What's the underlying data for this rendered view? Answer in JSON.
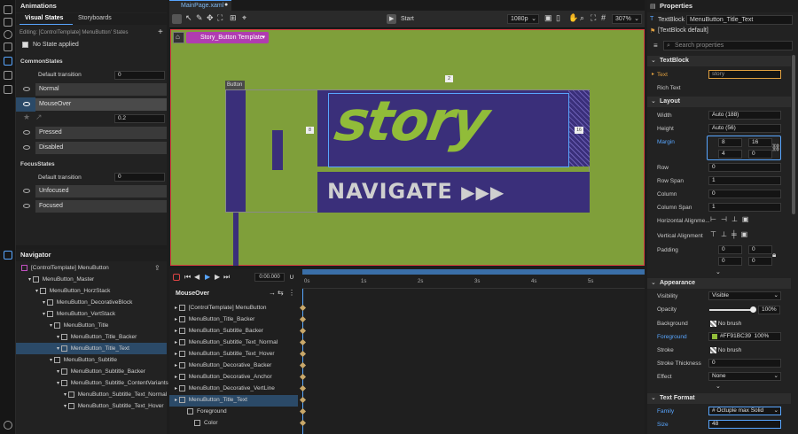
{
  "animations": {
    "title": "Animations",
    "tab_visual": "Visual States",
    "tab_story": "Storyboards",
    "editing": "Editing: [ControlTemplate] MenuButton' States",
    "no_state": "No State applied",
    "group1": "CommonStates",
    "default_transition": "Default transition",
    "dt1": "0",
    "states1": [
      "Normal",
      "MouseOver",
      "Pressed",
      "Disabled"
    ],
    "mouseover_value": "0.2",
    "group2": "FocusStates",
    "dt2": "0",
    "states2": [
      "Unfocused",
      "Focused"
    ]
  },
  "navigator": {
    "title": "Navigator",
    "items": [
      {
        "label": "[ControlTemplate] MenuButton",
        "level": 0
      },
      {
        "label": "MenuButton_Master",
        "level": 1
      },
      {
        "label": "MenuButton_HorzStack",
        "level": 2
      },
      {
        "label": "MenuButton_DecorativeBlock",
        "level": 3
      },
      {
        "label": "MenuButton_VertStack",
        "level": 3
      },
      {
        "label": "MenuButton_Title",
        "level": 4
      },
      {
        "label": "MenuButton_Title_Backer",
        "level": 5
      },
      {
        "label": "MenuButton_Title_Text",
        "level": 5
      },
      {
        "label": "MenuButton_Subtitle",
        "level": 4
      },
      {
        "label": "MenuButton_Subtitle_Backer",
        "level": 5
      },
      {
        "label": "MenuButton_Subtitle_ContentVariants",
        "level": 5
      },
      {
        "label": "MenuButton_Subtitle_Text_Normal",
        "level": 6
      },
      {
        "label": "MenuButton_Subtitle_Text_Hover",
        "level": 6
      }
    ]
  },
  "doc": {
    "tab": "MainPage.xaml",
    "start": "Start",
    "resolution": "1080p",
    "zoom": "307%",
    "template_label": "Story_Button Template",
    "button_label": "Button",
    "story": "story",
    "navigate": "NAVIGATE",
    "margin_top": "2",
    "margin_left": "8",
    "margin_right": "16"
  },
  "timeline": {
    "time": "0:00.000",
    "state": "MouseOver",
    "ticks": [
      "0s",
      "1s",
      "2s",
      "3s",
      "4s",
      "5s"
    ],
    "rows": [
      "[ControlTemplate] MenuButton",
      "MenuButton_Title_Backer",
      "MenuButton_Subtitle_Backer",
      "MenuButton_Subtitle_Text_Normal",
      "MenuButton_Subtitle_Text_Hover",
      "MenuButton_Decorative_Backer",
      "MenuButton_Decorative_Anchor",
      "MenuButton_Decorative_VertLine",
      "MenuButton_Title_Text",
      "Foreground",
      "Color"
    ]
  },
  "properties": {
    "title": "Properties",
    "element_type": "TextBlock",
    "element_name": "MenuButton_Title_Text",
    "style": "[TextBlock default]",
    "search_placeholder": "Search properties",
    "textblock_section": "TextBlock",
    "text_label": "Text",
    "text_value": "story",
    "richtext_label": "Rich Text",
    "layout_section": "Layout",
    "width_label": "Width",
    "width_value": "Auto (188)",
    "height_label": "Height",
    "height_value": "Auto (56)",
    "margin_label": "Margin",
    "margin_vals": [
      "8",
      "16",
      "4",
      "0"
    ],
    "row_label": "Row",
    "row_value": "0",
    "rowspan_label": "Row Span",
    "rowspan_value": "1",
    "column_label": "Column",
    "column_value": "0",
    "colspan_label": "Column Span",
    "colspan_value": "1",
    "halign_label": "Horizontal Alignme...",
    "valign_label": "Vertical Alignment",
    "padding_label": "Padding",
    "padding_vals": [
      "0",
      "0",
      "0",
      "0"
    ],
    "appearance_section": "Appearance",
    "visibility_label": "Visibility",
    "visibility_value": "Visible",
    "opacity_label": "Opacity",
    "opacity_value": "100%",
    "opacity_level": 1.0,
    "background_label": "Background",
    "background_value": "No brush",
    "foreground_label": "Foreground",
    "foreground_value": "#FF91BC39",
    "foreground_pct": "100%",
    "foreground_color": "#91BC39",
    "stroke_label": "Stroke",
    "stroke_value": "No brush",
    "strokethick_label": "Stroke Thickness",
    "strokethick_value": "0",
    "effect_label": "Effect",
    "effect_value": "None",
    "textformat_section": "Text Format",
    "family_label": "Family",
    "family_value": "# Octuple max Solid",
    "size_label": "Size",
    "size_value": "48"
  },
  "colors": {
    "accent": "#58a6ff",
    "canvas": "#7f9f3a",
    "title_backer": "#3a2f7a",
    "title_text": "#91BC39"
  }
}
